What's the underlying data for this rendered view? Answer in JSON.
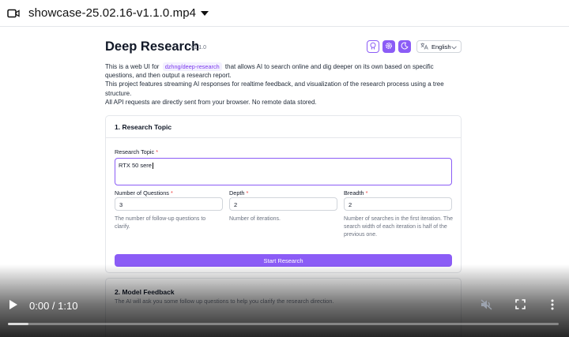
{
  "file": {
    "name": "showcase-25.02.16-v1.1.0.mp4"
  },
  "app": {
    "title": "Deep Research",
    "version": "v1.1.0",
    "language": "English"
  },
  "intro": {
    "line1_before": "This is a web UI for",
    "repo_tag": "dzhng/deep-research",
    "line1_after": "that allows AI to search online and dig deeper on its own based on specific questions, and then output a research report.",
    "line2": "This project features streaming AI responses for realtime feedback, and visualization of the research process using a tree structure.",
    "line3": "All API requests are directly sent from your browser. No remote data stored."
  },
  "research": {
    "section_title": "1. Research Topic",
    "topic_label": "Research Topic",
    "topic_value": "RTX 50 sere",
    "questions_label": "Number of Questions",
    "questions_value": "3",
    "questions_help": "The number of follow-up questions to clarify.",
    "depth_label": "Depth",
    "depth_value": "2",
    "depth_help": "Number of iterations.",
    "breadth_label": "Breadth",
    "breadth_value": "2",
    "breadth_help": "Number of searches in the first iteration. The search width of each iteration is half of the previous one.",
    "required_mark": "*",
    "start_label": "Start Research"
  },
  "feedback": {
    "section_title": "2. Model Feedback",
    "description": "The AI will ask you some follow up questions to help you clarify the research direction."
  },
  "player": {
    "time": "0:00 / 1:10",
    "buffered_fraction": 0.038,
    "icons": [
      "play-icon",
      "mute-icon",
      "fullscreen-icon",
      "more-icon"
    ]
  },
  "colors": {
    "accent": "#8b5cf6",
    "required": "#ef4444"
  }
}
